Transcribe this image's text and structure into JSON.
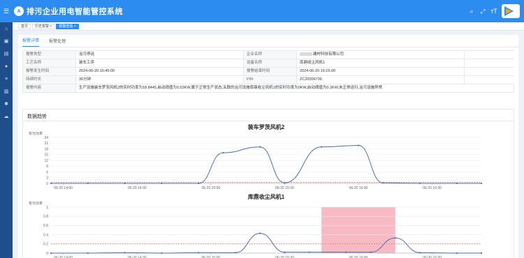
{
  "header": {
    "title": "排污企业用电智能管控系统",
    "logo_text": "A"
  },
  "icons": {
    "menu": "menu-icon",
    "search": "search-icon",
    "fullscreen": "fullscreen-icon",
    "font": "font-size-icon"
  },
  "tabs": [
    {
      "label": "首页"
    },
    {
      "label": "历史报警",
      "close": "×"
    },
    {
      "label": "报警查看",
      "close": "×"
    }
  ],
  "inner_tabs": [
    {
      "label": "报警详情"
    },
    {
      "label": "报警处理"
    }
  ],
  "details": {
    "type_label": "报警类型",
    "type_value": "治污停运",
    "company_label": "企业名称",
    "company_value": "建材科技有限公司",
    "process_label": "工艺名称",
    "process_value": "装车工序",
    "device_label": "设备名称",
    "device_value": "库鼎收尘风机1",
    "start_label": "报警发生时间",
    "start_value": "2024-06-20 15:45:00",
    "end_label": "报警结束时间",
    "end_value": "2024-06-20 16:15:00",
    "duration_label": "持续时长",
    "duration_value": "30分钟",
    "pin_label": "PIN",
    "pin_value": "ZC20006736",
    "content_label": "报警内容",
    "content_value": "生产设施装车罗茨风机2的实时功率为18.8445,启动阈值为0.53KW,属于正常生产状态,关联的治污设施库鼎收尘风机1的实时功率为0KW,启动阈值为0.2KW,未正常运行,治污设施异常"
  },
  "trend_title": "数据趋势",
  "colors": {
    "primary": "#2d8cf0",
    "line": "#4a6fb5",
    "threshold": "#e84a4a",
    "alarm_band": "#f5a3ad"
  },
  "chart_data": [
    {
      "type": "line",
      "title": "装车罗茨风机2",
      "ylabel": "有功功率",
      "ylim": [
        0,
        24
      ],
      "yticks": [
        0,
        3,
        6,
        9,
        12,
        15,
        18,
        21,
        24
      ],
      "xlim": [
        "06-20 13:55",
        "06-20 16:50"
      ],
      "xticks": [
        "06-20 14:00",
        "06-20 14:30",
        "06-20 15:00",
        "06-20 15:30",
        "06-20 16:00",
        "06-20 16:30"
      ],
      "threshold": 0.53,
      "series": [
        {
          "x": [
            "06-20 13:55",
            "06-20 14:10",
            "06-20 14:25",
            "06-20 14:40",
            "06-20 14:55",
            "06-20 15:05",
            "06-20 15:20",
            "06-20 15:30",
            "06-20 15:45",
            "06-20 16:00",
            "06-20 16:10",
            "06-20 16:25",
            "06-20 16:40",
            "06-20 16:50"
          ],
          "y": [
            0,
            0,
            0,
            0,
            0,
            16,
            19,
            0.3,
            19,
            19.8,
            0.3,
            0,
            0,
            0
          ]
        }
      ]
    },
    {
      "type": "line",
      "title": "库鼎收尘风机1",
      "ylabel": "有功功率",
      "ylim": [
        0,
        1
      ],
      "yticks": [
        0,
        0.2,
        0.4,
        0.6,
        0.8,
        1
      ],
      "xlim": [
        "06-20 13:55",
        "06-20 16:50"
      ],
      "xticks": [
        "06-20 14:00",
        "06-20 14:30",
        "06-20 15:00",
        "06-20 15:30",
        "06-20 16:00",
        "06-20 16:30"
      ],
      "threshold": 0.2,
      "alarm_range": [
        "06-20 15:45",
        "06-20 16:15"
      ],
      "series": [
        {
          "x": [
            "06-20 13:55",
            "06-20 14:10",
            "06-20 14:25",
            "06-20 14:40",
            "06-20 14:55",
            "06-20 15:10",
            "06-20 15:20",
            "06-20 15:30",
            "06-20 15:40",
            "06-20 15:55",
            "06-20 16:05",
            "06-20 16:15",
            "06-20 16:25",
            "06-20 16:40",
            "06-20 16:50"
          ],
          "y": [
            0,
            0,
            0.01,
            0,
            0.01,
            0.01,
            0.43,
            0.02,
            0.02,
            0.02,
            0.02,
            0.33,
            0.01,
            0,
            0
          ]
        }
      ]
    }
  ]
}
